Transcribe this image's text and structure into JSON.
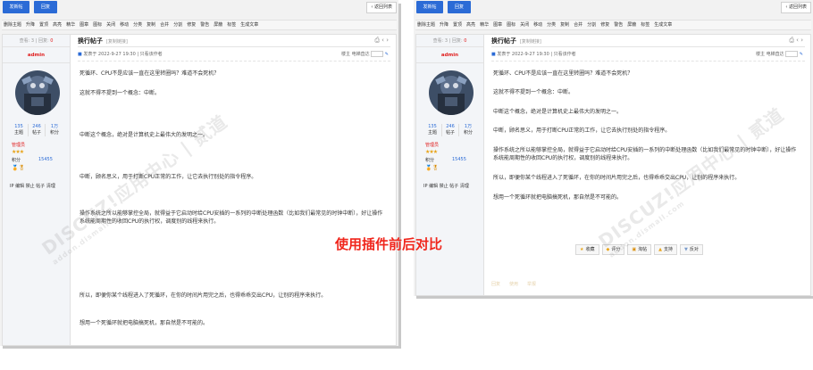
{
  "caption": "使用插件前后对比",
  "toolbar": {
    "new_post": "发新帖",
    "reply": "回复",
    "back": "返回列表"
  },
  "modbar": [
    "删除主题",
    "升降",
    "置顶",
    "高亮",
    "精华",
    "图章",
    "图标",
    "关闭",
    "移动",
    "分类",
    "复制",
    "合并",
    "分割",
    "修复",
    "警告",
    "屏蔽",
    "标签",
    "生成文章"
  ],
  "sidebar": {
    "views_label": "查看:",
    "views": "3",
    "replies_label": "回复:",
    "replies": "0",
    "author": "admin",
    "stats": [
      {
        "num": "135",
        "label": "主题"
      },
      {
        "num": "246",
        "label": "帖子"
      },
      {
        "num": "1万",
        "label": "积分"
      }
    ],
    "group": "管理员",
    "points_label": "积分",
    "points": "15455",
    "admin_links": "IP 编辑 禁止 帖子 清理"
  },
  "thread": {
    "title": "换行帖子",
    "copy_link": "[复制链接]",
    "posted": "发表于 2022-9-27 19:30",
    "separator": "|",
    "only_author": "只看该作者",
    "floor": "楼主",
    "goto": "电梯直达"
  },
  "left_paragraphs": [
    "死循环、CPU不是应该一直在这里转圈吗？难道不会死机？",
    "这就不得不提到一个概念：中断。",
    "中断这个概念，绝对是计算机史上最伟大的发明之一。",
    "中断，顾名思义，用于打断CPU正常的工作，让它去执行别处的指令程序。",
    "操作系统之所以能够掌控全局，就得益于它启动时给CPU安插的一系列的中断处理函数（比如我们最常见的时钟中断），好让操作系统能周期性的收回CPU的执行权，调度别的线程来执行。",
    "所以，即便你某个线程进入了死循环，在你的时间片用完之后，也得乖乖交出CPU，让别的程序来执行。",
    "想用一个死循环就把电脑搞死机，那自然是不可能的。"
  ],
  "right_paragraphs": [
    "死循环、CPU不是应该一直在这里转圈吗？难道不会死机？",
    "这就不得不提到一个概念：中断。",
    "中断这个概念，绝对是计算机史上最伟大的发明之一。",
    "中断，顾名思义，用于打断CPU正常的工作，让它去执行别处的指令程序。",
    "操作系统之所以能够掌控全局，就得益于它启动时给CPU安插的一系列的中断处理函数（比如我们最常见的时钟中断），好让操作系统能周期性的收回CPU的执行权，调度别的线程来执行。",
    "所以，即便你某个线程进入了死循环，在你的时间片用完之后，也得乖乖交出CPU，让别的程序来执行。",
    "想用一个死循环就把电脑搞死机，那自然是不可能的。"
  ],
  "actions": {
    "favorite": "收藏",
    "rate": "评分",
    "share": "淘帖",
    "support": "支持",
    "oppose": "反对"
  },
  "faint_actions": [
    "回复",
    "使用",
    "举报"
  ],
  "watermark": {
    "main": "DISCUZ!应用中心 | 贰道",
    "sub": "addon.dismall.com"
  },
  "colors": {
    "primary": "#2b6bd6",
    "accent_red": "#f0261c",
    "panel_bg": "#f2f2f2"
  }
}
